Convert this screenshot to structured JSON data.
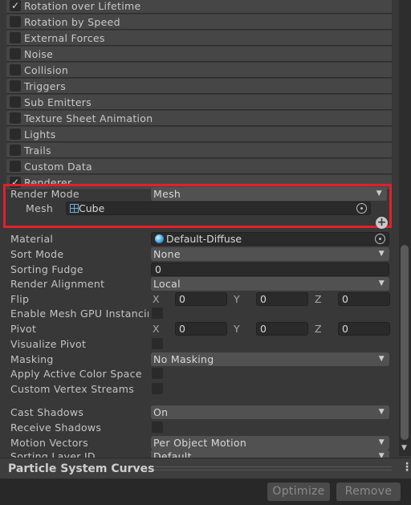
{
  "modules": [
    {
      "label": "Rotation over Lifetime",
      "checked": true
    },
    {
      "label": "Rotation by Speed",
      "checked": false
    },
    {
      "label": "External Forces",
      "checked": false
    },
    {
      "label": "Noise",
      "checked": false
    },
    {
      "label": "Collision",
      "checked": false
    },
    {
      "label": "Triggers",
      "checked": false
    },
    {
      "label": "Sub Emitters",
      "checked": false
    },
    {
      "label": "Texture Sheet Animation",
      "checked": false
    },
    {
      "label": "Lights",
      "checked": false
    },
    {
      "label": "Trails",
      "checked": false
    },
    {
      "label": "Custom Data",
      "checked": false
    },
    {
      "label": "Renderer",
      "checked": true
    }
  ],
  "renderer": {
    "render_mode": {
      "label": "Render Mode",
      "value": "Mesh"
    },
    "mesh": {
      "label": "Mesh",
      "value": "Cube"
    },
    "material": {
      "label": "Material",
      "value": "Default-Diffuse"
    },
    "sort_mode": {
      "label": "Sort Mode",
      "value": "None"
    },
    "sorting_fudge": {
      "label": "Sorting Fudge",
      "value": "0"
    },
    "render_alignment": {
      "label": "Render Alignment",
      "value": "Local"
    },
    "flip": {
      "label": "Flip",
      "x": "0",
      "y": "0",
      "z": "0"
    },
    "enable_gpu": {
      "label": "Enable Mesh GPU Instancing"
    },
    "pivot": {
      "label": "Pivot",
      "x": "0",
      "y": "0",
      "z": "0"
    },
    "visualize_pivot": {
      "label": "Visualize Pivot"
    },
    "masking": {
      "label": "Masking",
      "value": "No Masking"
    },
    "apply_color_space": {
      "label": "Apply Active Color Space"
    },
    "custom_vertex_streams": {
      "label": "Custom Vertex Streams"
    },
    "cast_shadows": {
      "label": "Cast Shadows",
      "value": "On"
    },
    "receive_shadows": {
      "label": "Receive Shadows"
    },
    "motion_vectors": {
      "label": "Motion Vectors",
      "value": "Per Object Motion"
    },
    "sorting_layer": {
      "label": "Sorting Layer ID",
      "value": "Default"
    },
    "axis": {
      "x": "X",
      "y": "Y",
      "z": "Z"
    }
  },
  "highlight_color": "#e0212b",
  "curves": {
    "title": "Particle System Curves"
  },
  "buttons": {
    "optimize": "Optimize",
    "remove": "Remove"
  }
}
